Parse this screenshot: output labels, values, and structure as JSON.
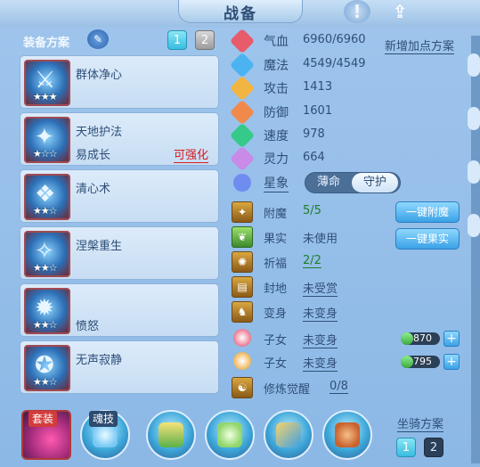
{
  "header": {
    "title": "战备"
  },
  "left": {
    "heading": "装备方案",
    "plan_buttons": [
      "1",
      "2"
    ],
    "skills": [
      {
        "name": "群体净心",
        "sub": "",
        "action": "",
        "stars": "★★★"
      },
      {
        "name": "天地护法",
        "sub": "易成长",
        "action": "可强化",
        "stars": "★☆☆"
      },
      {
        "name": "清心术",
        "sub": "",
        "action": "",
        "stars": "★★☆"
      },
      {
        "name": "涅槃重生",
        "sub": "",
        "action": "",
        "stars": "★★☆"
      },
      {
        "name": "",
        "sub": "愤怒",
        "action": "",
        "stars": "★★☆"
      },
      {
        "name": "无声寂静",
        "sub": "",
        "action": "",
        "stars": "★★☆"
      }
    ]
  },
  "stats": {
    "new_plan_label": "新增加点方案",
    "rows": [
      {
        "label": "气血",
        "value": "6960/6960",
        "icon": "heart-icon",
        "color": "#e85b6b"
      },
      {
        "label": "魔法",
        "value": "4549/4549",
        "icon": "mana-icon",
        "color": "#4bb4f0"
      },
      {
        "label": "攻击",
        "value": "1413",
        "icon": "attack-icon",
        "color": "#f2b541"
      },
      {
        "label": "防御",
        "value": "1601",
        "icon": "defense-icon",
        "color": "#f08a4b"
      },
      {
        "label": "速度",
        "value": "978",
        "icon": "speed-icon",
        "color": "#35c98a"
      },
      {
        "label": "灵力",
        "value": "664",
        "icon": "spirit-icon",
        "color": "#c98ae8"
      }
    ],
    "star": {
      "label": "星象",
      "options": [
        "薄命",
        "守护"
      ],
      "selected": "守护"
    }
  },
  "items": [
    {
      "label": "附魔",
      "value": "5/5",
      "style": "green",
      "button": "一键附魔"
    },
    {
      "label": "果实",
      "value": "未使用",
      "style": "plain",
      "button": "一键果实"
    },
    {
      "label": "祈福",
      "value": "2/2",
      "style": "green",
      "button": ""
    },
    {
      "label": "封地",
      "value": "未受赏",
      "style": "link",
      "button": ""
    },
    {
      "label": "变身",
      "value": "未变身",
      "style": "link",
      "button": ""
    },
    {
      "label": "子女",
      "value": "未变身",
      "style": "link",
      "bar": {
        "value": "870",
        "fill": 0.3
      }
    },
    {
      "label": "子女",
      "value": "未变身",
      "style": "link",
      "bar": {
        "value": "795",
        "fill": 0.3
      }
    },
    {
      "label": "修炼觉醒",
      "value": "0/8",
      "style": "link",
      "button": ""
    }
  ],
  "bottom": {
    "suit_label": "套装",
    "soul_label": "魂技",
    "mount_label": "坐骑方案",
    "mount_buttons": [
      "1",
      "2"
    ]
  }
}
